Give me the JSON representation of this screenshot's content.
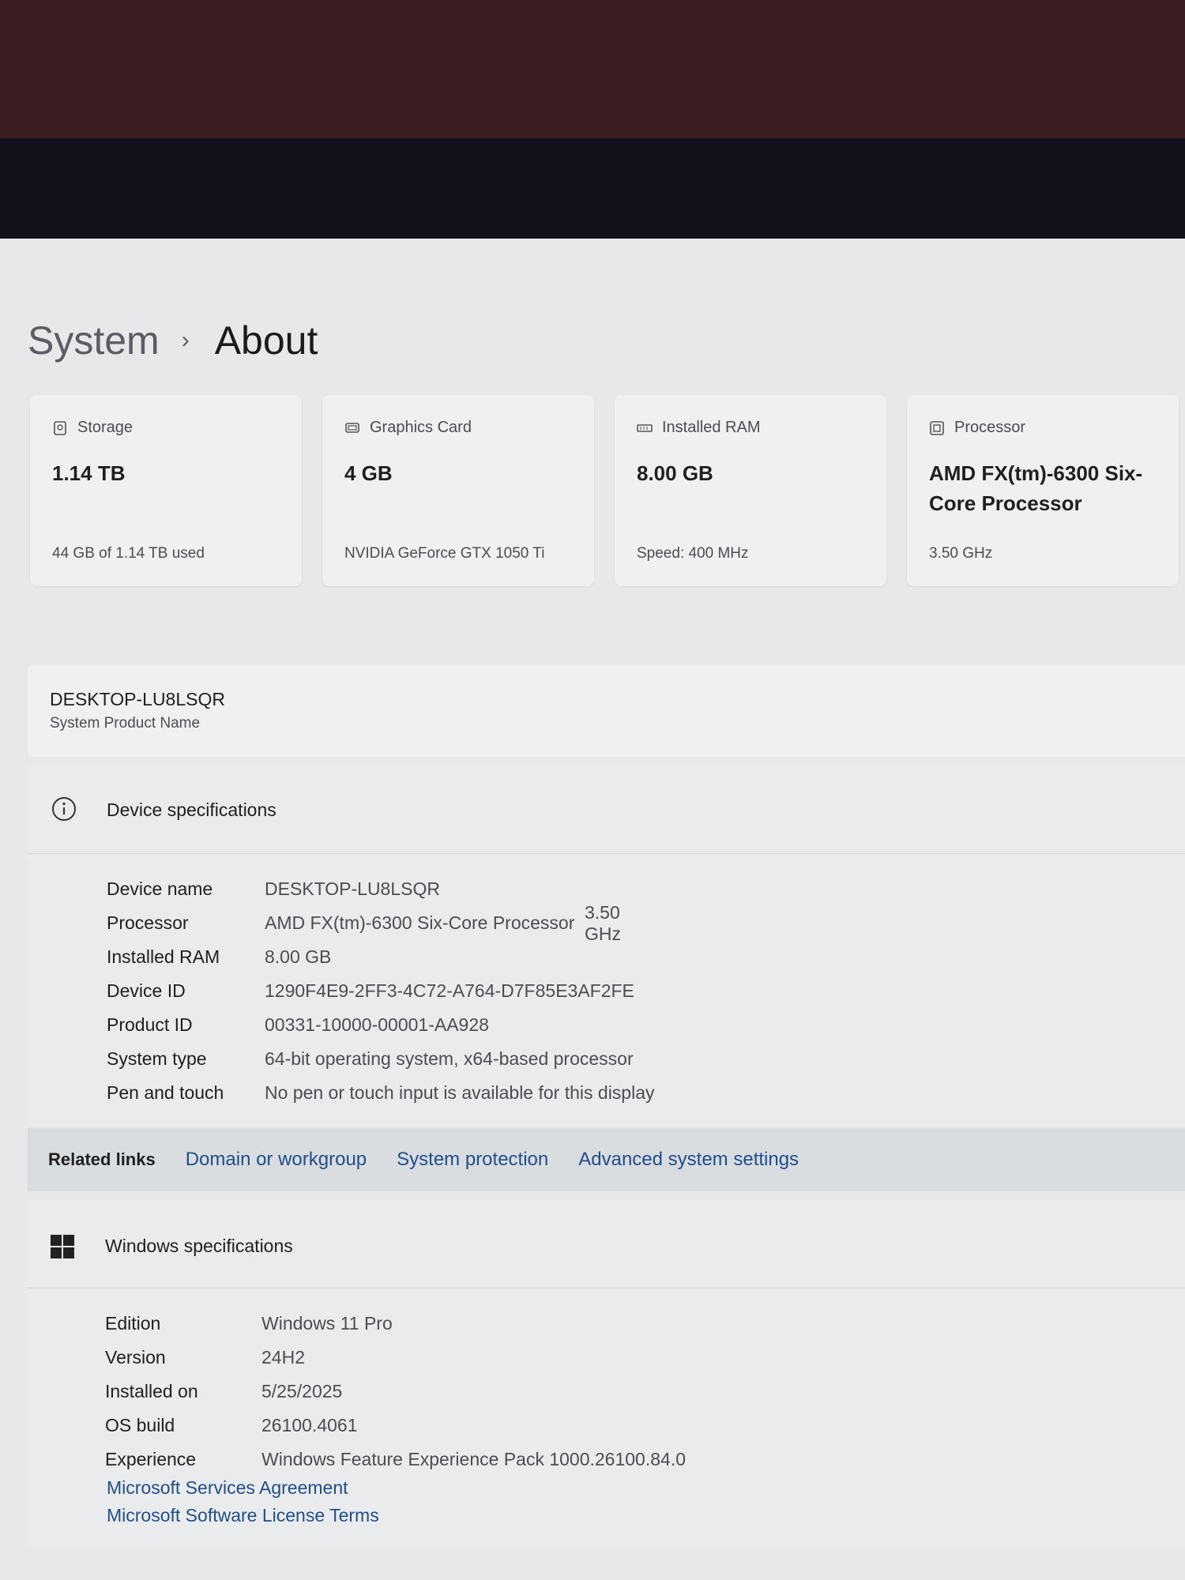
{
  "header": {
    "crumb": "System",
    "separator": "›",
    "current": "About"
  },
  "cards": [
    {
      "caption": "Storage",
      "icon": "storage-icon",
      "value": "1.14 TB",
      "sub": "44 GB of 1.14 TB used"
    },
    {
      "caption": "Graphics Card",
      "icon": "graphics-card-icon",
      "value": "4 GB",
      "sub": "NVIDIA GeForce GTX 1050 Ti"
    },
    {
      "caption": "Installed RAM",
      "icon": "ram-icon",
      "value": "8.00 GB",
      "sub": "Speed: 400 MHz"
    },
    {
      "caption": "Processor",
      "icon": "processor-icon",
      "value": "AMD FX(tm)-6300 Six-Core Processor",
      "sub": "3.50 GHz"
    }
  ],
  "device_card": {
    "name": "DESKTOP-LU8LSQR",
    "label": "System Product Name"
  },
  "device_specs": {
    "title": "Device specifications",
    "rows": [
      {
        "key": "Device name",
        "value": "DESKTOP-LU8LSQR"
      },
      {
        "key": "Processor",
        "value": "AMD FX(tm)-6300 Six-Core Processor",
        "extra": "3.50 GHz"
      },
      {
        "key": "Installed RAM",
        "value": "8.00 GB"
      },
      {
        "key": "Device ID",
        "value": "1290F4E9-2FF3-4C72-A764-D7F85E3AF2FE"
      },
      {
        "key": "Product ID",
        "value": "00331-10000-00001-AA928"
      },
      {
        "key": "System type",
        "value": "64-bit operating system, x64-based processor"
      },
      {
        "key": "Pen and touch",
        "value": "No pen or touch input is available for this display"
      }
    ]
  },
  "related_links": {
    "label": "Related links",
    "links": [
      "Domain or workgroup",
      "System protection",
      "Advanced system settings"
    ]
  },
  "windows_specs": {
    "title": "Windows specifications",
    "rows": [
      {
        "key": "Edition",
        "value": "Windows 11 Pro"
      },
      {
        "key": "Version",
        "value": "24H2"
      },
      {
        "key": "Installed on",
        "value": "5/25/2025"
      },
      {
        "key": "OS build",
        "value": "26100.4061"
      },
      {
        "key": "Experience",
        "value": "Windows Feature Experience Pack 1000.26100.84.0"
      }
    ],
    "links": [
      "Microsoft Services Agreement",
      "Microsoft Software License Terms"
    ]
  },
  "colors": {
    "link": "#1f4e8c",
    "background": "#e6e8ea",
    "card": "#eef0f2"
  }
}
